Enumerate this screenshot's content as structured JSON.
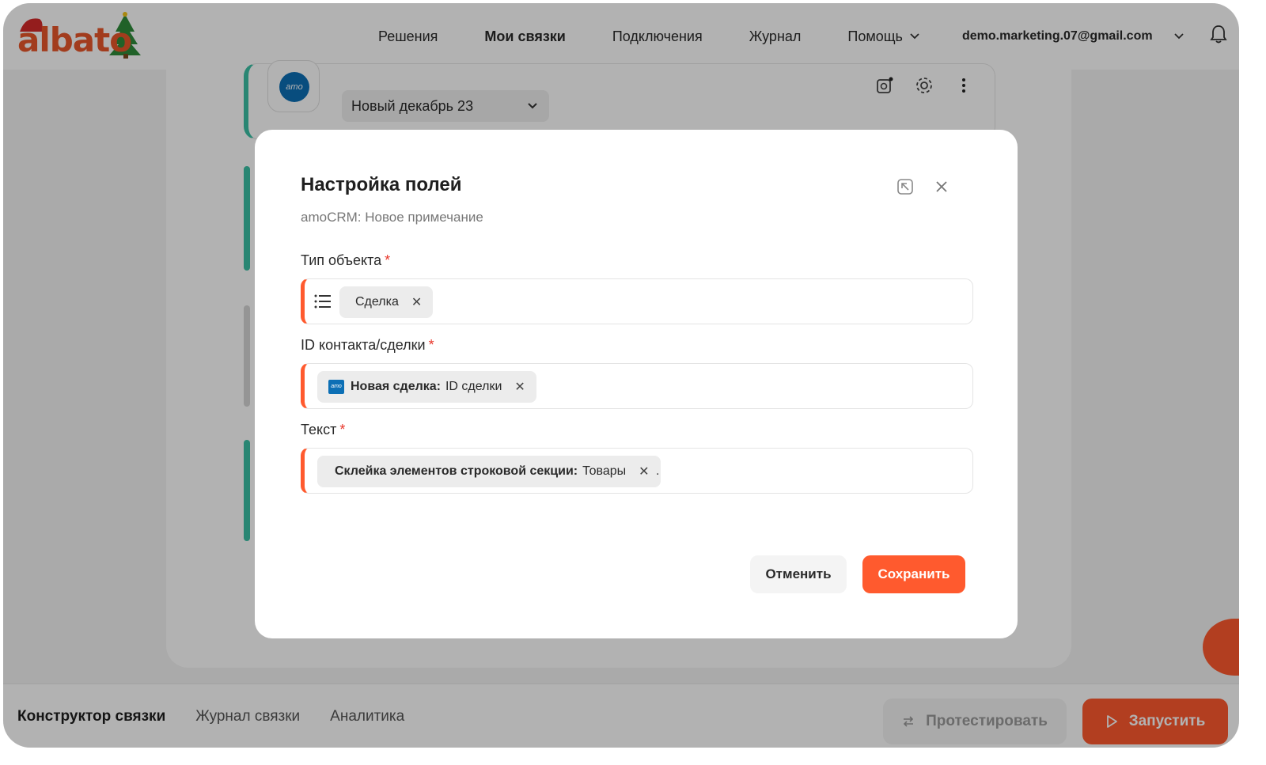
{
  "header": {
    "logo_text": "albato",
    "nav": [
      {
        "label": "Решения"
      },
      {
        "label": "Мои связки"
      },
      {
        "label": "Подключения"
      },
      {
        "label": "Журнал"
      },
      {
        "label": "Помощь"
      }
    ],
    "user_email": "demo.marketing.07@gmail.com"
  },
  "background": {
    "card_logo": "amo",
    "card_select_value": "Новый декабрь 23"
  },
  "modal": {
    "title": "Настройка полей",
    "subtitle": "amoCRM: Новое примечание",
    "fields": [
      {
        "label": "Тип объекта",
        "chip_value": "Сделка"
      },
      {
        "label": "ID контакта/сделки",
        "chip_badge": "amo",
        "chip_source": "Новая сделка:",
        "chip_value": "ID сделки"
      },
      {
        "label": "Текст",
        "chip_source": "Склейка элементов строковой секции:",
        "chip_value": "Товары",
        "trailing_text": "."
      }
    ],
    "required_mark": "*",
    "cancel_label": "Отменить",
    "save_label": "Сохранить"
  },
  "bottombar": {
    "tabs": [
      {
        "label": "Конструктор связки"
      },
      {
        "label": "Журнал связки"
      },
      {
        "label": "Аналитика"
      }
    ],
    "test_label": "Протестировать",
    "run_label": "Запустить"
  },
  "colors": {
    "accent": "#ff5a2e",
    "teal": "#3cc1a5",
    "amo_blue": "#0c6fb5"
  }
}
